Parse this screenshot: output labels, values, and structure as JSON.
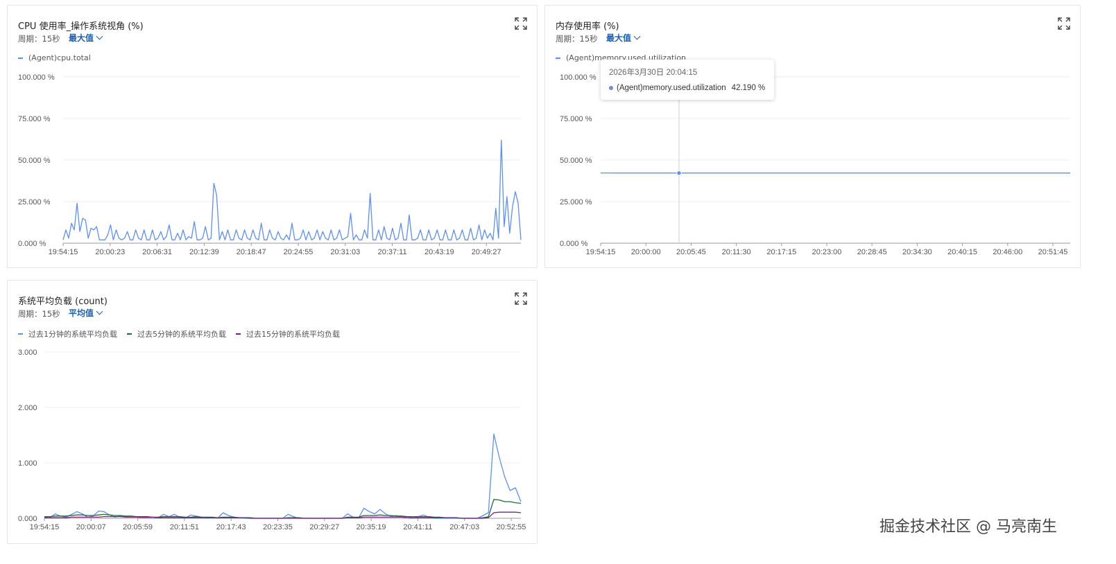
{
  "panels": {
    "cpu": {
      "title": "CPU 使用率_操作系统视角 (%)",
      "period": "周期：15秒",
      "aggregation": "最大值",
      "legend": [
        {
          "name": "(Agent)cpu.total",
          "color": "#5b8ff9"
        }
      ]
    },
    "memory": {
      "title": "内存使用率 (%)",
      "period": "周期：15秒",
      "aggregation": "最大值",
      "legend": [
        {
          "name": "(Agent)memory.used.utilization",
          "color": "#5b8ff9"
        }
      ],
      "tooltip": {
        "time": "2026年3月30日 20:04:15",
        "series": "(Agent)memory.used.utilization",
        "value": "42.190 %"
      }
    },
    "load": {
      "title": "系统平均负载 (count)",
      "period": "周期：15秒",
      "aggregation": "平均值",
      "legend": [
        {
          "name": "过去1分钟的系统平均负载",
          "color": "#5b8ff9"
        },
        {
          "name": "过去5分钟的系统平均负载",
          "color": "#1e6b2e"
        },
        {
          "name": "过去15分钟的系统平均负载",
          "color": "#7b1f7f"
        }
      ]
    }
  },
  "watermark": "掘金技术社区 @ 马亮南生",
  "chart_data": [
    {
      "type": "line",
      "title": "CPU 使用率_操作系统视角 (%)",
      "y_ticks": [
        "0.000 %",
        "25.000 %",
        "50.000 %",
        "75.000 %",
        "100.000 %"
      ],
      "ylim": [
        0,
        100
      ],
      "x_ticks": [
        "19:54:15",
        "20:00:23",
        "20:06:31",
        "20:12:39",
        "20:18:47",
        "20:24:55",
        "20:31:03",
        "20:37:11",
        "20:43:19",
        "20:49:27"
      ],
      "series": [
        {
          "name": "(Agent)cpu.total",
          "color": "#5b8ff9",
          "values": [
            2,
            8,
            3,
            12,
            8,
            24,
            7,
            15,
            14,
            3,
            9,
            8,
            10,
            2,
            2,
            2,
            5,
            11,
            2,
            8,
            3,
            2,
            3,
            7,
            2,
            2,
            8,
            3,
            2,
            8,
            2,
            2,
            8,
            2,
            3,
            7,
            2,
            4,
            11,
            2,
            2,
            6,
            2,
            8,
            2,
            4,
            3,
            13,
            2,
            2,
            3,
            10,
            2,
            3,
            36,
            29,
            2,
            7,
            2,
            8,
            2,
            2,
            8,
            3,
            2,
            8,
            3,
            2,
            8,
            3,
            2,
            12,
            2,
            2,
            8,
            3,
            2,
            7,
            3,
            2,
            5,
            2,
            12,
            2,
            2,
            3,
            8,
            2,
            7,
            2,
            3,
            8,
            2,
            7,
            3,
            2,
            8,
            2,
            3,
            8,
            2,
            3,
            4,
            18,
            2,
            5,
            2,
            2,
            8,
            3,
            30,
            2,
            2,
            8,
            2,
            10,
            3,
            2,
            9,
            2,
            3,
            12,
            2,
            2,
            17,
            2,
            2,
            3,
            8,
            2,
            2,
            8,
            2,
            3,
            8,
            2,
            2,
            8,
            2,
            2,
            8,
            2,
            3,
            8,
            2,
            2,
            9,
            2,
            3,
            11,
            2,
            8,
            3,
            6,
            2,
            21,
            3,
            62,
            10,
            28,
            6,
            22,
            31,
            24,
            2
          ]
        }
      ]
    },
    {
      "type": "line",
      "title": "内存使用率 (%)",
      "y_ticks": [
        "0.000 %",
        "25.000 %",
        "50.000 %",
        "75.000 %",
        "100.000 %"
      ],
      "ylim": [
        0,
        100
      ],
      "x_ticks": [
        "19:54:15",
        "20:00:00",
        "20:05:45",
        "20:11:30",
        "20:17:15",
        "20:23:00",
        "20:28:45",
        "20:34:30",
        "20:40:15",
        "20:46:00",
        "20:51:45"
      ],
      "series": [
        {
          "name": "(Agent)memory.used.utilization",
          "color": "#5b8ff9",
          "values": [
            42.25,
            42.2,
            42.19,
            42.19,
            42.2,
            42.2,
            42.19,
            42.2,
            42.2,
            42.21,
            42.21,
            42.2,
            42.2,
            42.21,
            42.22,
            42.22,
            42.21,
            42.22,
            42.22,
            42.22
          ]
        }
      ],
      "highlight": {
        "x": "20:04:15",
        "y": 42.19
      }
    },
    {
      "type": "line",
      "title": "系统平均负载 (count)",
      "y_ticks": [
        "0.000",
        "1.000",
        "2.000",
        "3.000"
      ],
      "ylim": [
        0,
        3
      ],
      "x_ticks": [
        "19:54:15",
        "20:00:07",
        "20:05:59",
        "20:11:51",
        "20:17:43",
        "20:23:35",
        "20:29:27",
        "20:35:19",
        "20:41:11",
        "20:47:03",
        "20:52:55"
      ],
      "series": [
        {
          "name": "过去1分钟的系统平均负载",
          "color": "#5b8ff9",
          "values": [
            0.02,
            0.01,
            0.08,
            0.04,
            0.02,
            0.07,
            0.12,
            0.08,
            0.02,
            0.04,
            0.13,
            0.12,
            0.06,
            0.02,
            0.04,
            0.03,
            0.04,
            0.02,
            0.01,
            0.01,
            0.0,
            0.01,
            0.07,
            0.03,
            0.07,
            0.02,
            0.0,
            0.06,
            0.04,
            0.02,
            0.0,
            0.01,
            0.0,
            0.1,
            0.05,
            0.02,
            0.01,
            0.0,
            0.0,
            0.0,
            0.0,
            0.0,
            0.0,
            0.0,
            0.0,
            0.07,
            0.03,
            0.0,
            0.0,
            0.0,
            0.0,
            0.0,
            0.0,
            0.0,
            0.0,
            0.0,
            0.08,
            0.02,
            0.0,
            0.18,
            0.12,
            0.08,
            0.16,
            0.08,
            0.03,
            0.05,
            0.02,
            0.0,
            0.0,
            0.03,
            0.06,
            0.02,
            0.0,
            0.0,
            0.0,
            0.0,
            0.0,
            0.0,
            0.0,
            0.0,
            0.0,
            0.05,
            0.1,
            1.52,
            1.1,
            0.75,
            0.5,
            0.55,
            0.3
          ]
        },
        {
          "name": "过去5分钟的系统平均负载",
          "color": "#1e6b2e",
          "values": [
            0.03,
            0.03,
            0.04,
            0.04,
            0.04,
            0.05,
            0.06,
            0.06,
            0.05,
            0.05,
            0.06,
            0.07,
            0.06,
            0.05,
            0.05,
            0.04,
            0.04,
            0.03,
            0.03,
            0.03,
            0.02,
            0.02,
            0.03,
            0.03,
            0.03,
            0.03,
            0.02,
            0.02,
            0.03,
            0.02,
            0.02,
            0.02,
            0.01,
            0.02,
            0.02,
            0.02,
            0.01,
            0.01,
            0.01,
            0.0,
            0.0,
            0.0,
            0.0,
            0.0,
            0.0,
            0.01,
            0.01,
            0.01,
            0.0,
            0.0,
            0.0,
            0.0,
            0.0,
            0.0,
            0.0,
            0.0,
            0.02,
            0.02,
            0.02,
            0.05,
            0.05,
            0.05,
            0.06,
            0.05,
            0.05,
            0.04,
            0.04,
            0.03,
            0.03,
            0.03,
            0.03,
            0.03,
            0.02,
            0.02,
            0.01,
            0.01,
            0.01,
            0.0,
            0.0,
            0.0,
            0.0,
            0.01,
            0.03,
            0.34,
            0.33,
            0.3,
            0.3,
            0.28,
            0.27
          ]
        },
        {
          "name": "过去15分钟的系统平均负载",
          "color": "#7b1f7f",
          "values": [
            0.01,
            0.01,
            0.01,
            0.01,
            0.01,
            0.02,
            0.02,
            0.02,
            0.02,
            0.02,
            0.02,
            0.03,
            0.03,
            0.03,
            0.03,
            0.02,
            0.02,
            0.02,
            0.02,
            0.02,
            0.02,
            0.01,
            0.01,
            0.01,
            0.01,
            0.01,
            0.01,
            0.01,
            0.01,
            0.01,
            0.01,
            0.01,
            0.01,
            0.01,
            0.01,
            0.01,
            0.01,
            0.01,
            0.0,
            0.0,
            0.0,
            0.0,
            0.0,
            0.0,
            0.0,
            0.0,
            0.0,
            0.0,
            0.0,
            0.0,
            0.0,
            0.0,
            0.0,
            0.0,
            0.0,
            0.0,
            0.01,
            0.01,
            0.01,
            0.02,
            0.02,
            0.02,
            0.02,
            0.02,
            0.02,
            0.02,
            0.02,
            0.02,
            0.01,
            0.01,
            0.01,
            0.01,
            0.01,
            0.01,
            0.01,
            0.01,
            0.01,
            0.0,
            0.0,
            0.0,
            0.0,
            0.0,
            0.01,
            0.1,
            0.11,
            0.11,
            0.11,
            0.11,
            0.1
          ]
        }
      ]
    }
  ]
}
